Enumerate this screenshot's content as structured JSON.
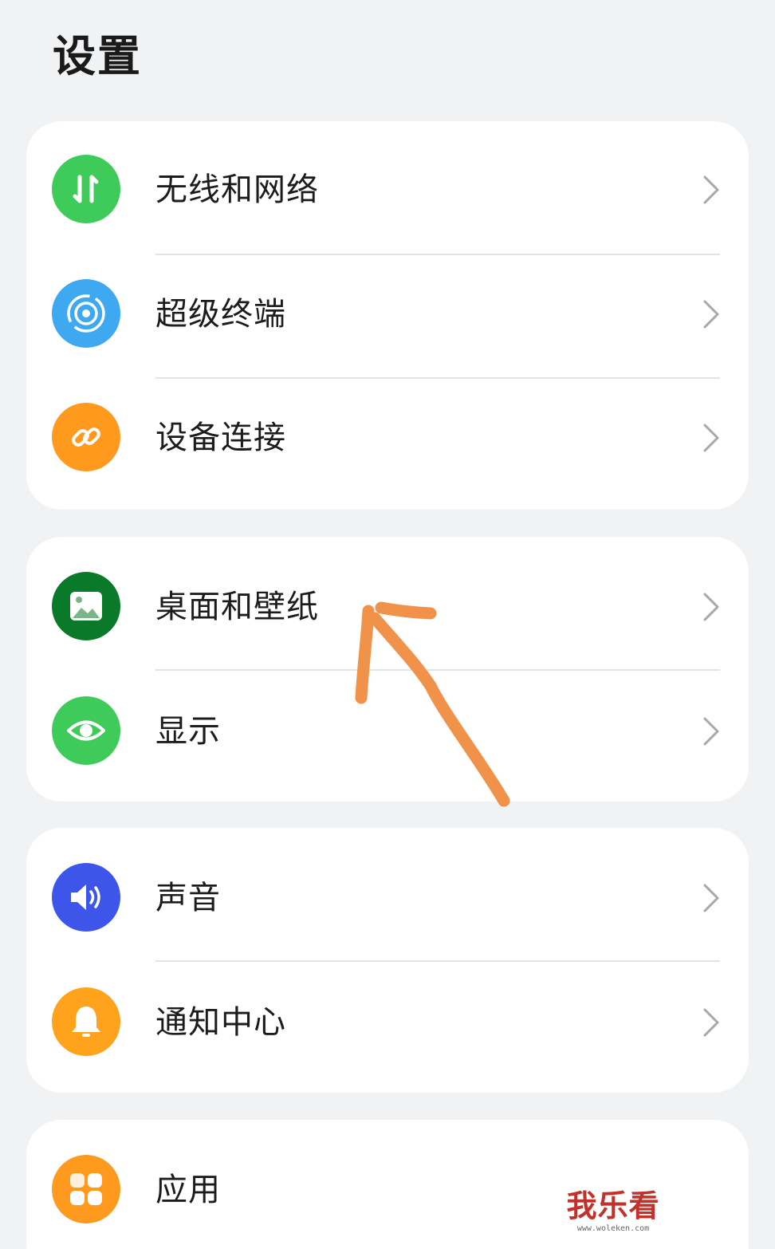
{
  "header": {
    "title": "设置"
  },
  "groups": [
    {
      "items": [
        {
          "label": "无线和网络",
          "icon": "wireless-network-icon",
          "color": "#3ecb5a"
        },
        {
          "label": "超级终端",
          "icon": "super-device-icon",
          "color": "#3ea9f0"
        },
        {
          "label": "设备连接",
          "icon": "link-icon",
          "color": "#ff9a1e"
        }
      ]
    },
    {
      "items": [
        {
          "label": "桌面和壁纸",
          "icon": "wallpaper-icon",
          "color": "#0a7a2a"
        },
        {
          "label": "显示",
          "icon": "eye-icon",
          "color": "#3ecb5a"
        }
      ]
    },
    {
      "items": [
        {
          "label": "声音",
          "icon": "speaker-icon",
          "color": "#3d55e8"
        },
        {
          "label": "通知中心",
          "icon": "bell-icon",
          "color": "#ffa21c"
        }
      ]
    },
    {
      "items": [
        {
          "label": "应用",
          "icon": "apps-icon",
          "color": "#ff9a1e"
        }
      ]
    }
  ],
  "annotation": {
    "icon": "hand-drawn-arrow",
    "color": "#f0924a"
  },
  "watermark": {
    "brand": "我乐看",
    "url": "www.woleken.com",
    "color": "#c2322c"
  }
}
